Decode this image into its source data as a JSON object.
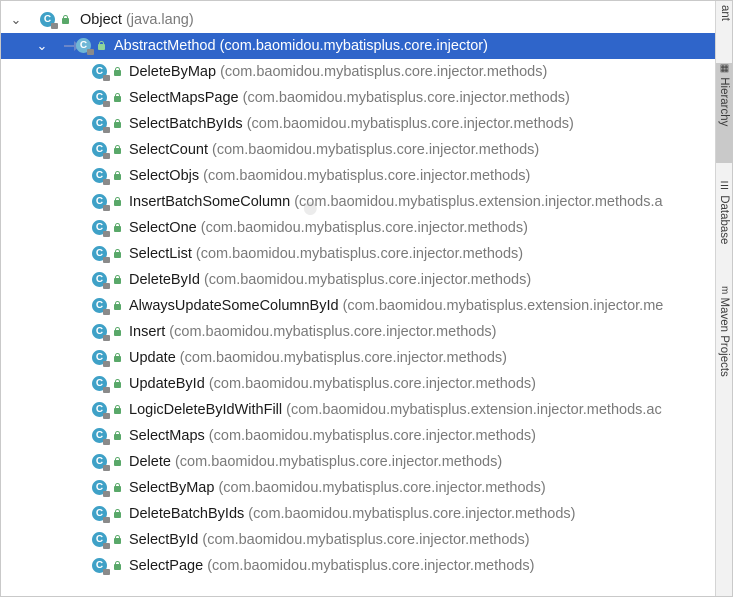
{
  "root": {
    "name": "Object",
    "package": "(java.lang)"
  },
  "selected": {
    "name": "AbstractMethod",
    "package": "(com.baomidou.mybatisplus.core.injector)"
  },
  "children": [
    {
      "name": "DeleteByMap",
      "package": "(com.baomidou.mybatisplus.core.injector.methods)"
    },
    {
      "name": "SelectMapsPage",
      "package": "(com.baomidou.mybatisplus.core.injector.methods)"
    },
    {
      "name": "SelectBatchByIds",
      "package": "(com.baomidou.mybatisplus.core.injector.methods)"
    },
    {
      "name": "SelectCount",
      "package": "(com.baomidou.mybatisplus.core.injector.methods)"
    },
    {
      "name": "SelectObjs",
      "package": "(com.baomidou.mybatisplus.core.injector.methods)"
    },
    {
      "name": "InsertBatchSomeColumn",
      "package": "(com.baomidou.mybatisplus.extension.injector.methods.a"
    },
    {
      "name": "SelectOne",
      "package": "(com.baomidou.mybatisplus.core.injector.methods)"
    },
    {
      "name": "SelectList",
      "package": "(com.baomidou.mybatisplus.core.injector.methods)"
    },
    {
      "name": "DeleteById",
      "package": "(com.baomidou.mybatisplus.core.injector.methods)"
    },
    {
      "name": "AlwaysUpdateSomeColumnById",
      "package": "(com.baomidou.mybatisplus.extension.injector.me"
    },
    {
      "name": "Insert",
      "package": "(com.baomidou.mybatisplus.core.injector.methods)"
    },
    {
      "name": "Update",
      "package": "(com.baomidou.mybatisplus.core.injector.methods)"
    },
    {
      "name": "UpdateById",
      "package": "(com.baomidou.mybatisplus.core.injector.methods)"
    },
    {
      "name": "LogicDeleteByIdWithFill",
      "package": "(com.baomidou.mybatisplus.extension.injector.methods.ac"
    },
    {
      "name": "SelectMaps",
      "package": "(com.baomidou.mybatisplus.core.injector.methods)"
    },
    {
      "name": "Delete",
      "package": "(com.baomidou.mybatisplus.core.injector.methods)"
    },
    {
      "name": "SelectByMap",
      "package": "(com.baomidou.mybatisplus.core.injector.methods)"
    },
    {
      "name": "DeleteBatchByIds",
      "package": "(com.baomidou.mybatisplus.core.injector.methods)"
    },
    {
      "name": "SelectById",
      "package": "(com.baomidou.mybatisplus.core.injector.methods)"
    },
    {
      "name": "SelectPage",
      "package": "(com.baomidou.mybatisplus.core.injector.methods)"
    }
  ],
  "sidebar_tabs": [
    {
      "label": "ant",
      "icon": "ant-icon"
    },
    {
      "label": "Hierarchy",
      "icon": "hierarchy-icon"
    },
    {
      "label": "Database",
      "icon": "database-icon"
    },
    {
      "label": "Maven Projects",
      "icon": "maven-icon"
    }
  ],
  "colors": {
    "selection": "#2f65ca",
    "class_icon": "#3fa1c7",
    "package_text": "#7a7a7a"
  }
}
